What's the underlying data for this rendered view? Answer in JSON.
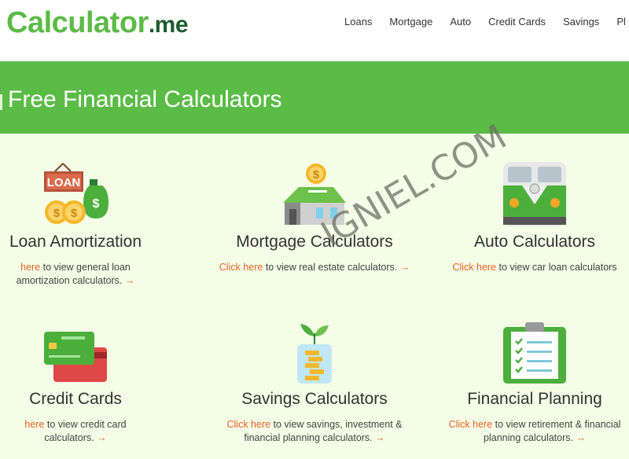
{
  "header": {
    "logo_main": "Calculator",
    "logo_suffix": ".me",
    "nav": [
      "Loans",
      "Mortgage",
      "Auto",
      "Credit Cards",
      "Savings",
      "Pl"
    ]
  },
  "hero": {
    "title": "Free Financial Calculators"
  },
  "cards": [
    {
      "title": "Loan Amortization",
      "link": "here",
      "desc": " to view general loan amortization calculators. ",
      "arrow": "→",
      "icon": "loan-icon",
      "icon_text": "LOAN"
    },
    {
      "title": "Mortgage Calculators",
      "link": "Click here",
      "desc": " to view real estate calculators. ",
      "arrow": "→",
      "icon": "house-icon"
    },
    {
      "title": "Auto Calculators",
      "link": "Click here",
      "desc": " to view car loan calculators",
      "arrow": "",
      "icon": "bus-icon"
    },
    {
      "title": "Credit Cards",
      "link": "here",
      "desc": " to view credit card calculators. ",
      "arrow": "→",
      "icon": "credit-card-icon"
    },
    {
      "title": "Savings Calculators",
      "link": "Click here",
      "desc": " to view savings, investment & financial planning calculators. ",
      "arrow": "→",
      "icon": "savings-jar-icon"
    },
    {
      "title": "Financial Planning",
      "link": "Click here",
      "desc": " to view retirement & financial planning calculators. ",
      "arrow": "→",
      "icon": "clipboard-icon"
    }
  ],
  "watermark": "IGNIEL.COM",
  "colors": {
    "green": "#5bbb47",
    "dark_green": "#1e5b2e",
    "link": "#e8622a",
    "background": "#f4fde6"
  }
}
